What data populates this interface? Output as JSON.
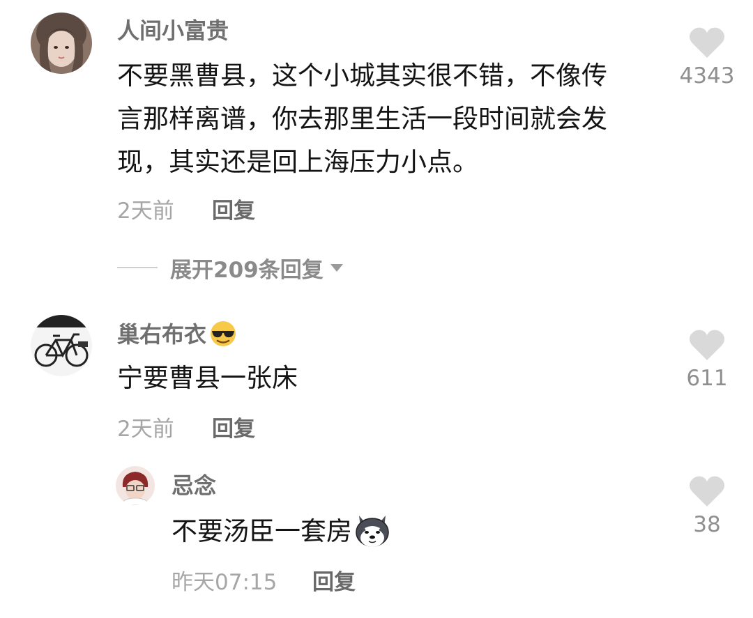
{
  "comments": [
    {
      "username": "人间小富贵",
      "text_lines": [
        "不要黑曹县，这个小城其实很不错，不像传",
        "言那样离谱，你去那里生活一段时间就会发",
        "现，其实还是回上海压力小点。"
      ],
      "time": "2天前",
      "reply_label": "回复",
      "likes": "4343",
      "expand_label": "展开209条回复"
    },
    {
      "username": "巢右布衣",
      "username_emoji": "sunglasses-emoji",
      "text": "宁要曹县一张床",
      "time": "2天前",
      "reply_label": "回复",
      "likes": "611",
      "replies": [
        {
          "username": "忌念",
          "text": "不要汤臣一套房",
          "sticker": "husky-dog-sticker",
          "time": "昨天07:15",
          "reply_label": "回复",
          "likes": "38"
        }
      ]
    }
  ],
  "colors": {
    "username": "#6f6f6f",
    "text": "#141414",
    "meta": "#a6a6a6",
    "heart": "#d9d9d9"
  }
}
